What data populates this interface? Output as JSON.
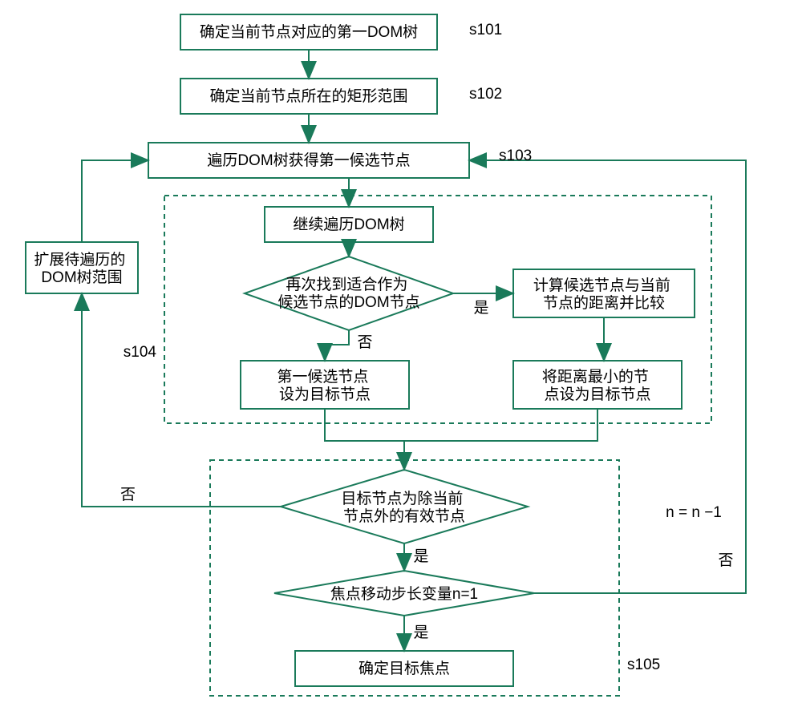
{
  "steps": {
    "s101": {
      "label": "s101",
      "text": "确定当前节点对应的第一DOM树"
    },
    "s102": {
      "label": "s102",
      "text": "确定当前节点所在的矩形范围"
    },
    "s103": {
      "label": "s103",
      "text": "遍历DOM树获得第一候选节点"
    },
    "s104": {
      "label": "s104"
    },
    "s105": {
      "label": "s105"
    }
  },
  "nodes": {
    "continueTraverse": "继续遍历DOM树",
    "foundCandidate": "再次找到适合作为\n候选节点的DOM节点",
    "calcDistance": "计算候选节点与当前\n节点的距离并比较",
    "setFirstAsTarget": "第一候选节点\n设为目标节点",
    "setMinDistAsTarget": "将距离最小的节\n点设为目标节点",
    "isValidTarget": "目标节点为除当前\n节点外的有效节点",
    "stepEqOne": "焦点移动步长变量n=1",
    "confirmTarget": "确定目标焦点",
    "expandScope": "扩展待遍历的\nDOM树范围"
  },
  "labels": {
    "yes": "是",
    "no": "否",
    "nDecrement": "n = n −1"
  }
}
